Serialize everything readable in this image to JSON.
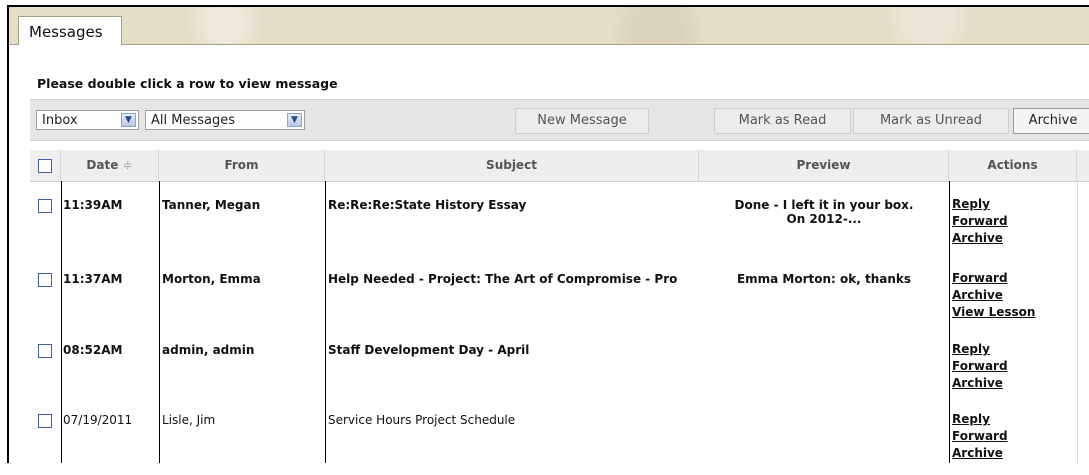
{
  "tabs": [
    {
      "label": "Messages"
    }
  ],
  "instructions": "Please double click a row to view message",
  "toolbar": {
    "folder_select": "Inbox",
    "filter_select": "All Messages",
    "new_message": "New Message",
    "mark_read": "Mark as Read",
    "mark_unread": "Mark as Unread",
    "archive": "Archive"
  },
  "table": {
    "headers": {
      "date": "Date",
      "sort_indicator": "≑",
      "from": "From",
      "subject": "Subject",
      "preview": "Preview",
      "actions": "Actions"
    },
    "rows": [
      {
        "date": "11:39AM",
        "from": "Tanner, Megan",
        "subject": "Re:Re:Re:State History Essay",
        "preview_line1": "Done - I left it in your box.",
        "preview_line2": "On 2012-...",
        "actions": [
          "Reply",
          "Forward",
          "Archive"
        ],
        "unread": true
      },
      {
        "date": "11:37AM",
        "from": "Morton, Emma",
        "subject": "Help Needed - Project: The Art of Compromise - Pro",
        "preview_line1": "Emma Morton: ok, thanks",
        "preview_line2": "",
        "actions": [
          "Forward",
          "Archive",
          "View Lesson"
        ],
        "unread": true
      },
      {
        "date": "08:52AM",
        "from": "admin, admin",
        "subject": "Staff Development Day - April",
        "preview_line1": "",
        "preview_line2": "",
        "actions": [
          "Reply",
          "Forward",
          "Archive"
        ],
        "unread": true
      },
      {
        "date": "07/19/2011",
        "from": "Lisle, Jim",
        "subject": "Service Hours Project Schedule",
        "preview_line1": "",
        "preview_line2": "",
        "actions": [
          "Reply",
          "Forward",
          "Archive"
        ],
        "unread": false
      }
    ]
  },
  "colors": {
    "accent_checkbox": "#3b63a8",
    "toolbar_bg": "#e6e6e6",
    "tabbar_bg": "#e4ddc8"
  }
}
